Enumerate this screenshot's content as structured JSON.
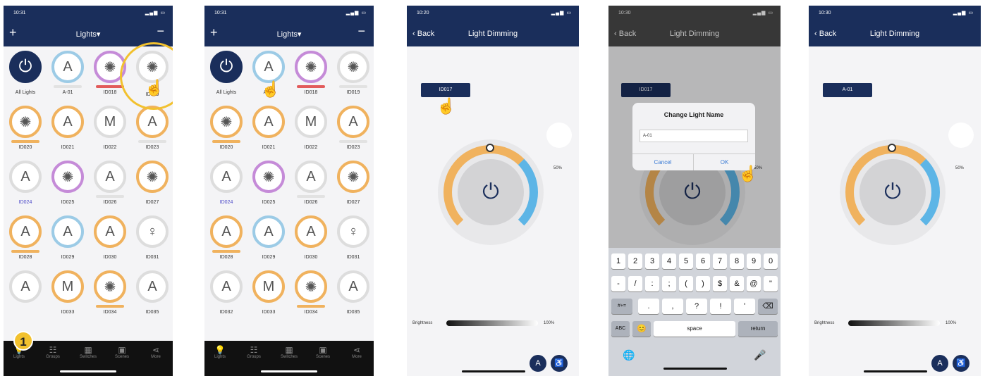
{
  "step_number": "1",
  "screens": [
    {
      "time": "10:31",
      "title": "Lights▾",
      "plus": "+",
      "minus": "−",
      "lights": [
        "All Lights",
        "A-01",
        "ID018",
        "ID019",
        "ID020",
        "ID021",
        "ID022",
        "ID023",
        "ID024",
        "ID025",
        "ID026",
        "ID027",
        "ID028",
        "ID029",
        "ID030",
        "ID031",
        "",
        "ID033",
        "ID034",
        "ID035"
      ]
    },
    {
      "time": "10:31",
      "title": "Lights▾",
      "plus": "+",
      "minus": "−",
      "lights": [
        "All Lights",
        "A-01",
        "ID018",
        "ID019",
        "ID020",
        "ID021",
        "ID022",
        "ID023",
        "ID024",
        "ID025",
        "ID026",
        "ID027",
        "ID028",
        "ID029",
        "ID030",
        "ID031",
        "ID032",
        "ID033",
        "ID034",
        "ID035"
      ]
    },
    {
      "time": "10:20",
      "back": "Back",
      "title": "Light Dimming",
      "name_tag": "ID017",
      "percent": "50%",
      "brightness_label": "Brightness",
      "brightness_value": "100%",
      "brightness": 1.0
    },
    {
      "time": "10:30",
      "back": "Back",
      "title": "Light Dimming",
      "name_tag": "ID017",
      "percent": "50%",
      "dialog": {
        "title": "Change Light Name",
        "input": "A-01",
        "cancel": "Cancel",
        "ok": "OK"
      },
      "keyboard": {
        "row1": [
          "1",
          "2",
          "3",
          "4",
          "5",
          "6",
          "7",
          "8",
          "9",
          "0"
        ],
        "row2": [
          "-",
          "/",
          ":",
          ";",
          "(",
          ")",
          "$",
          "&",
          "@",
          "\""
        ],
        "row3": [
          "#+=",
          ".",
          ",",
          "?",
          "!",
          "'",
          "⌫"
        ],
        "abc": "ABC",
        "space": "space",
        "return": "return"
      }
    },
    {
      "time": "10:30",
      "back": "Back",
      "title": "Light Dimming",
      "name_tag": "A-01",
      "percent": "50%",
      "brightness_label": "Brightness",
      "brightness_value": "100%",
      "brightness": 1.0
    }
  ],
  "tabs": [
    "Lights",
    "Groups",
    "Switches",
    "Scenes",
    "More"
  ],
  "icons": {
    "power": "⏻",
    "bulb": "💡",
    "back": "‹",
    "mic": "🎤",
    "globe": "🌐",
    "emoji": "😊",
    "hand": "☝"
  }
}
